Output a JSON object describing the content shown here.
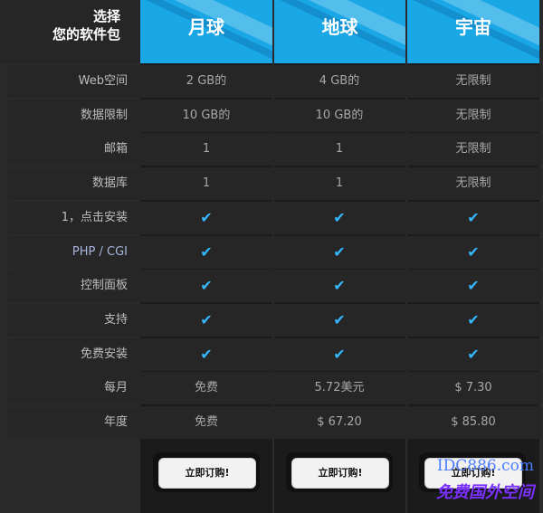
{
  "header": {
    "title_line1": "选择",
    "title_line2": "您的软件包"
  },
  "plans": [
    {
      "name": "月球"
    },
    {
      "name": "地球"
    },
    {
      "name": "宇宙"
    }
  ],
  "features": [
    {
      "label": "Web空间",
      "values": [
        "2 GB的",
        "4 GB的",
        "无限制"
      ],
      "type": "text"
    },
    {
      "label": "数据限制",
      "values": [
        "10 GB的",
        "10 GB的",
        "无限制"
      ],
      "type": "text"
    },
    {
      "label": "邮箱",
      "values": [
        "1",
        "1",
        "无限制"
      ],
      "type": "text"
    },
    {
      "label": "数据库",
      "values": [
        "1",
        "1",
        "无限制"
      ],
      "type": "text"
    },
    {
      "label": "1，点击安装",
      "values": [
        "✔",
        "✔",
        "✔"
      ],
      "type": "check"
    },
    {
      "label": "PHP / CGI",
      "values": [
        "✔",
        "✔",
        "✔"
      ],
      "type": "check"
    },
    {
      "label": "控制面板",
      "values": [
        "✔",
        "✔",
        "✔"
      ],
      "type": "check"
    },
    {
      "label": "支持",
      "values": [
        "✔",
        "✔",
        "✔"
      ],
      "type": "check"
    },
    {
      "label": "免费安装",
      "values": [
        "✔",
        "✔",
        "✔"
      ],
      "type": "check"
    },
    {
      "label": "每月",
      "values": [
        "免费",
        "5.72美元",
        "$ 7.30"
      ],
      "type": "text"
    },
    {
      "label": "年度",
      "values": [
        "免费",
        "$ 67.20",
        "$ 85.80"
      ],
      "type": "text"
    }
  ],
  "order_button_label": "立即订购!",
  "watermark": {
    "line1": "IDC886.com",
    "line2": "免费国外空间"
  },
  "colors": {
    "header_blue": "#1aa7e6",
    "check_blue": "#35b7ff"
  }
}
